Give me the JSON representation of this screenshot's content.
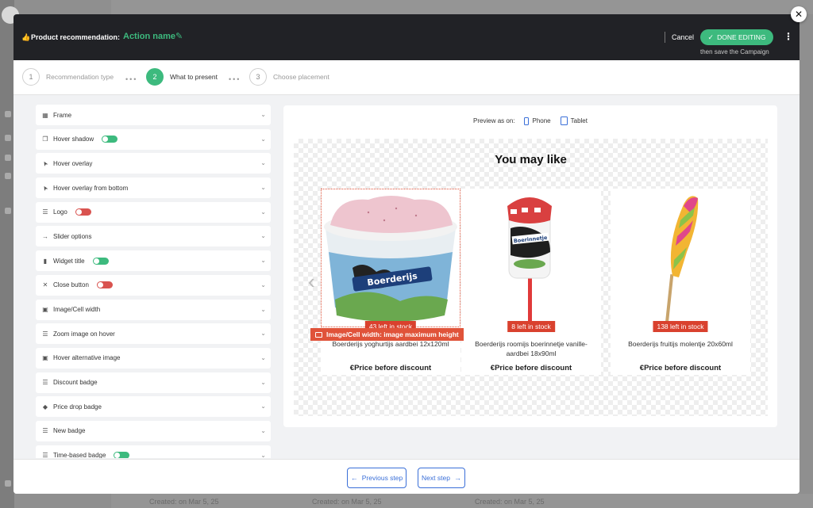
{
  "header": {
    "title": "Product recommendation:",
    "action_name": "Action name",
    "cancel": "Cancel",
    "done": "DONE EDITING",
    "done_sub": "then save the Campaign"
  },
  "steps": [
    {
      "num": "1",
      "label": "Recommendation type"
    },
    {
      "num": "2",
      "label": "What to present"
    },
    {
      "num": "3",
      "label": "Choose placement"
    }
  ],
  "options": [
    {
      "label": "Frame",
      "icon": "grid-icon"
    },
    {
      "label": "Hover shadow",
      "icon": "copy-icon",
      "toggle": "on"
    },
    {
      "label": "Hover overlay",
      "icon": "cursor-icon"
    },
    {
      "label": "Hover overlay from bottom",
      "icon": "cursor-icon"
    },
    {
      "label": "Logo",
      "icon": "list-icon",
      "toggle": "off"
    },
    {
      "label": "Slider options",
      "icon": "arrow-right-icon"
    },
    {
      "label": "Widget title",
      "icon": "bookmark-icon",
      "toggle": "on"
    },
    {
      "label": "Close button",
      "icon": "close-icon",
      "toggle": "off"
    },
    {
      "label": "Image/Cell width",
      "icon": "image-icon"
    },
    {
      "label": "Zoom image on hover",
      "icon": "list-icon"
    },
    {
      "label": "Hover alternative image",
      "icon": "image-icon"
    },
    {
      "label": "Discount badge",
      "icon": "list-icon"
    },
    {
      "label": "Price drop badge",
      "icon": "tag-icon"
    },
    {
      "label": "New badge",
      "icon": "list-icon"
    },
    {
      "label": "Time-based badge",
      "icon": "list-icon",
      "toggle": "on"
    }
  ],
  "preview": {
    "label": "Preview as on:",
    "phone": "Phone",
    "tablet": "Tablet",
    "title": "You may like",
    "selection_label": "Image/Cell width: image maximum height",
    "products": [
      {
        "stock": "43 left in stock",
        "name": "Boerderijs yoghurtijs aardbei 12x120ml",
        "price": "€Price before discount"
      },
      {
        "stock": "8 left in stock",
        "name": "Boerderijs roomijs boerinnetje vanille-aardbei 18x90ml",
        "price": "€Price before discount"
      },
      {
        "stock": "138 left in stock",
        "name": "Boerderijs fruitijs molentje 20x60ml",
        "price": "€Price before discount"
      }
    ]
  },
  "footer": {
    "prev": "Previous step",
    "next": "Next step"
  },
  "background": {
    "created_labels": [
      "Created: on Mar 5, 25",
      "Created: on Mar 5, 25",
      "Created: on Mar 5, 25"
    ]
  },
  "colors": {
    "accent_green": "#3dba7e",
    "accent_blue": "#3a6fd8",
    "badge_red": "#d9412e",
    "header_dark": "#212226"
  }
}
